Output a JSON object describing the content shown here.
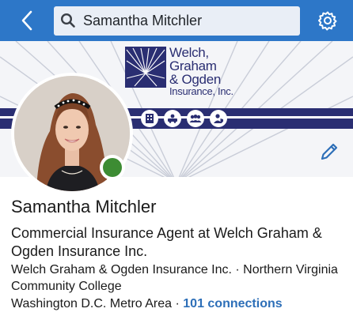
{
  "header": {
    "search_value": "Samantha Mitchler"
  },
  "icons": {
    "back": "chevron-left-icon",
    "search": "search-icon",
    "settings": "gear-icon",
    "edit": "pencil-icon"
  },
  "colors": {
    "topbar": "#2d77c8",
    "brand_navy": "#2a2e72",
    "link": "#2d6fb8",
    "online": "#3d8c33"
  },
  "banner": {
    "logo_line1": "Welch,",
    "logo_line2": "Graham",
    "logo_line3": "& Ogden",
    "logo_line4": "Insurance, Inc."
  },
  "profile": {
    "name": "Samantha Mitchler",
    "headline": "Commercial Insurance Agent at Welch Graham & Ogden Insurance Inc.",
    "summary": "Welch Graham & Ogden Insurance Inc. · Northern Virginia Community College",
    "location": "Washington D.C. Metro Area",
    "separator": " · ",
    "connections": "101 connections"
  }
}
